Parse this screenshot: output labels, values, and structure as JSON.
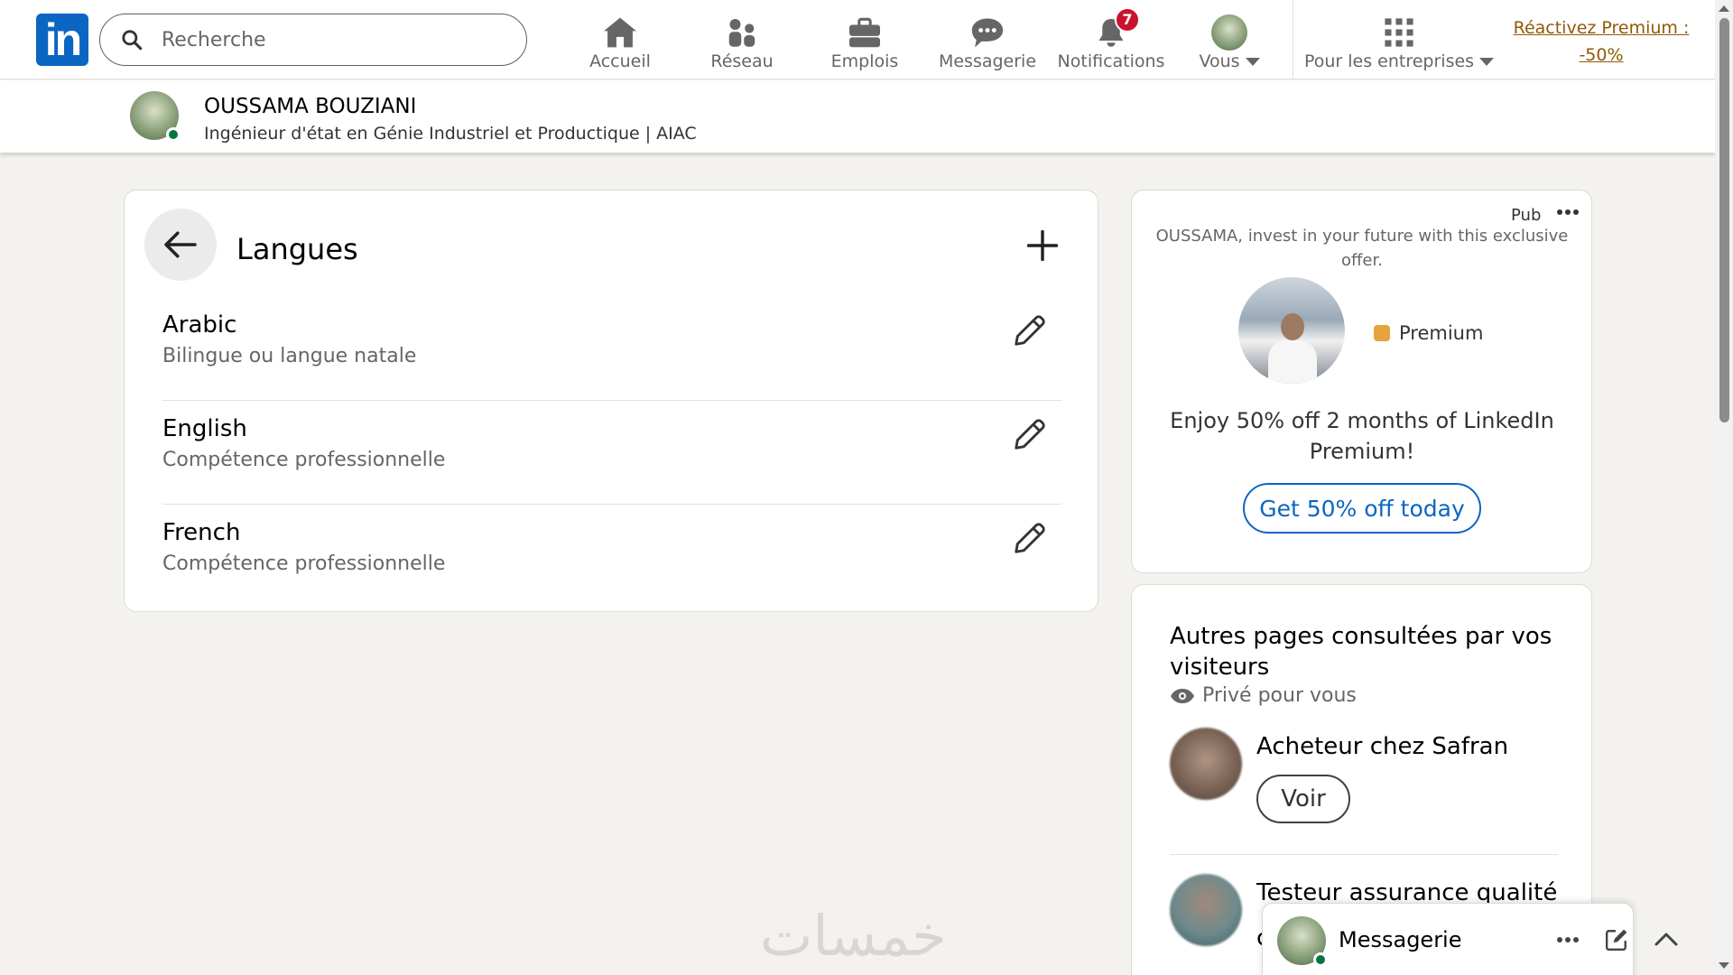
{
  "nav": {
    "search_placeholder": "Recherche",
    "items": [
      {
        "label": "Accueil",
        "icon": "home-icon"
      },
      {
        "label": "Réseau",
        "icon": "people-icon"
      },
      {
        "label": "Emplois",
        "icon": "briefcase-icon"
      },
      {
        "label": "Messagerie",
        "icon": "messaging-icon"
      },
      {
        "label": "Notifications",
        "icon": "bell-icon",
        "badge": "7"
      },
      {
        "label": "Vous",
        "icon": "avatar"
      },
      {
        "label": "Pour les entreprises",
        "icon": "grid-icon"
      }
    ],
    "premium_link": "Réactivez Premium : -50%"
  },
  "profile": {
    "name": "OUSSAMA BOUZIANI",
    "headline": "Ingénieur d'état en Génie Industriel et Productique | AIAC"
  },
  "languages": {
    "title": "Langues",
    "items": [
      {
        "name": "Arabic",
        "level": "Bilingue ou langue natale"
      },
      {
        "name": "English",
        "level": "Compétence professionnelle"
      },
      {
        "name": "French",
        "level": "Compétence professionnelle"
      }
    ]
  },
  "ad": {
    "tag": "Pub",
    "text": "OUSSAMA, invest in your future with this exclusive offer.",
    "premium_label": "Premium",
    "offer": "Enjoy 50% off 2 months of LinkedIn Premium!",
    "cta": "Get 50% off today"
  },
  "other_pages": {
    "title": "Autres pages consultées par vos visiteurs",
    "subtitle": "Privé pour vous",
    "people": [
      {
        "title": "Acheteur chez Safran",
        "action": "Voir"
      },
      {
        "title": "Testeur assurance qualité",
        "line2": "c"
      }
    ]
  },
  "messaging": {
    "label": "Messagerie"
  },
  "watermark": "خمسات",
  "colors": {
    "brand": "#0a66c2",
    "badge": "#cb112d",
    "premium_link": "#915907",
    "online": "#057642"
  }
}
